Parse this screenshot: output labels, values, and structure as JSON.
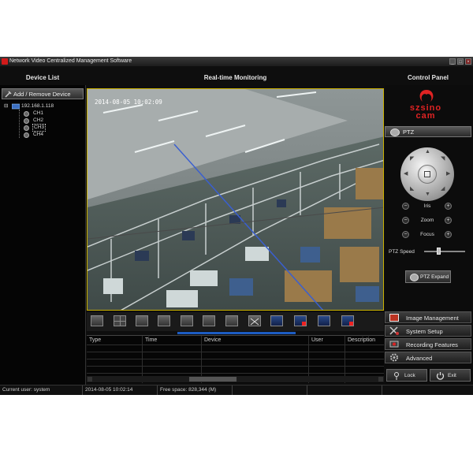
{
  "window": {
    "title": "Network Video Centralized Management Software",
    "buttons": [
      "_",
      "□",
      "×"
    ]
  },
  "sections": {
    "device_list": "Device List",
    "realtime": "Real-time Monitoring",
    "control_panel": "Control Panel"
  },
  "devices": {
    "add_remove": "Add / Remove Device",
    "host": "192.168.1.118",
    "channels": [
      "CH1",
      "CH2",
      "CH3",
      "CH4"
    ],
    "selected": "CH3"
  },
  "video": {
    "timestamp": "2014-08-05 10:02:09"
  },
  "table": {
    "columns": [
      "Type",
      "Time",
      "Device",
      "User",
      "Description"
    ]
  },
  "control": {
    "brand_line1": "szsino",
    "brand_line2": "cam",
    "ptz_tab": "PTZ",
    "iris": "Iris",
    "zoom": "Zoom",
    "focus": "Focus",
    "minus": "−",
    "plus": "+",
    "ptz_speed": "PTZ Speed",
    "ptz_speed_level": 0.35,
    "ptz_expand": "PTZ Expand",
    "menu": [
      "Image Management",
      "System Setup",
      "Recording Features",
      "Advanced"
    ],
    "lock": "Lock",
    "exit": "Exit"
  },
  "status": {
    "user": "Current user: system",
    "datetime": "2014-08-05 10:02:14",
    "free_space": "Free space: 828,344 (M)"
  },
  "colors": {
    "brand_red": "#e02323",
    "video_border": "#c9b000"
  }
}
